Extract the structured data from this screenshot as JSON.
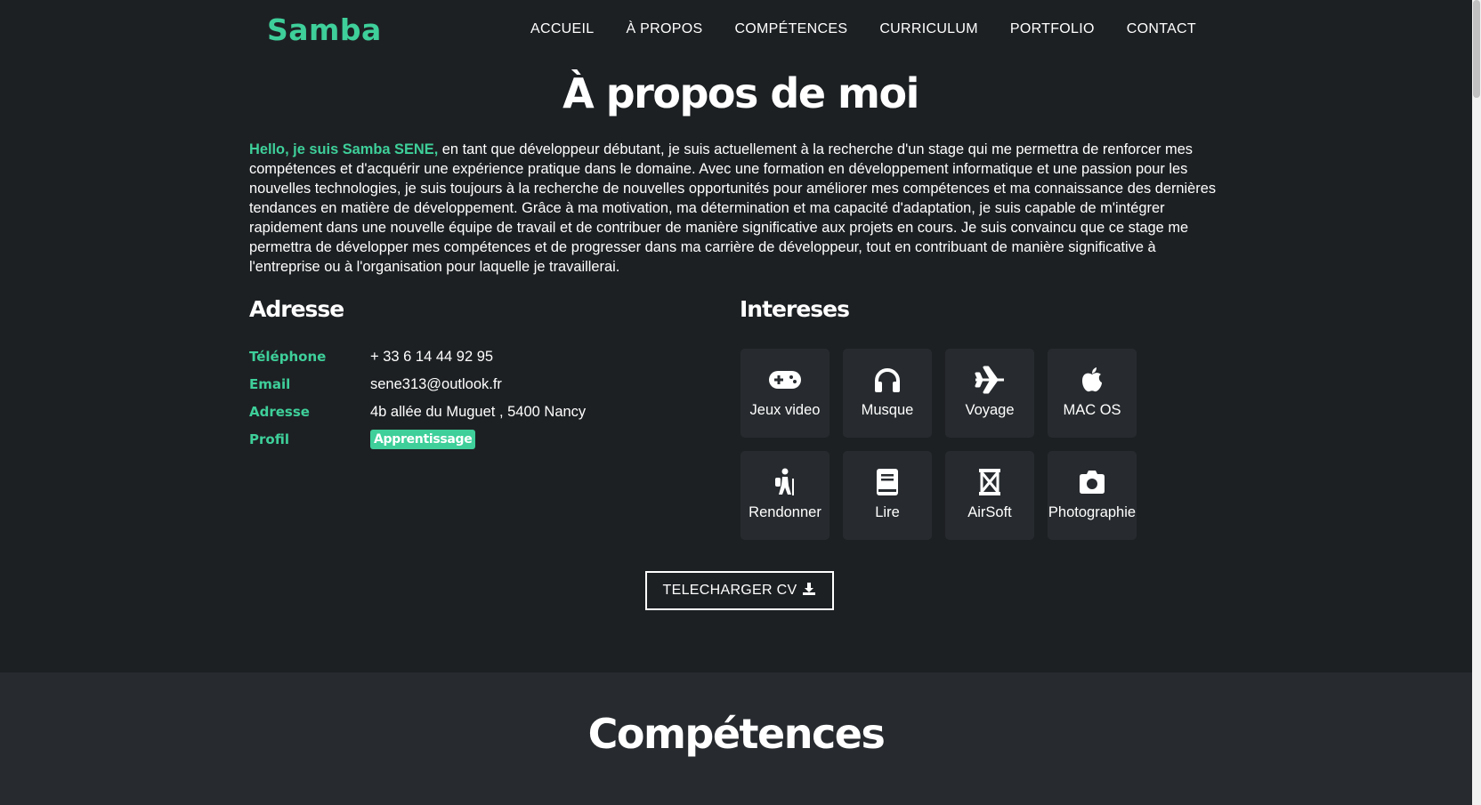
{
  "brand": {
    "logo": "Samba",
    "accent_color": "#3ecf9a",
    "bg_color": "#1d2023",
    "card_color": "#272b2f"
  },
  "nav": {
    "items": [
      "ACCUEIL",
      "À PROPOS",
      "COMPÉTENCES",
      "CURRICULUM",
      "PORTFOLIO",
      "CONTACT"
    ]
  },
  "about": {
    "title": "À propos de moi",
    "intro_highlight": "Hello, je suis Samba SENE,",
    "intro_text": " en tant que développeur débutant, je suis actuellement à la recherche d'un stage qui me permettra de renforcer mes compétences et d'acquérir une expérience pratique dans le domaine. Avec une formation en développement informatique et une passion pour les nouvelles technologies, je suis toujours à la recherche de nouvelles opportunités pour améliorer mes compétences et ma connaissance des dernières tendances en matière de développement. Grâce à ma motivation, ma détermination et ma capacité d'adaptation, je suis capable de m'intégrer rapidement dans une nouvelle équipe de travail et de contribuer de manière significative aux projets en cours. Je suis convaincu que ce stage me permettra de développer mes compétences et de progresser dans ma carrière de développeur, tout en contribuant de manière significative à l'entreprise ou à l'organisation pour laquelle je travaillerai."
  },
  "address": {
    "title": "Adresse",
    "rows": [
      {
        "label": "Téléphone",
        "value": "+ 33 6 14 44 92 95"
      },
      {
        "label": "Email",
        "value": "sene313@outlook.fr"
      },
      {
        "label": "Adresse",
        "value": "4b allée du Muguet , 5400 Nancy"
      },
      {
        "label": "Profil",
        "value": "Apprentissage"
      }
    ]
  },
  "interests": {
    "title": "Intereses",
    "items": [
      {
        "label": "Jeux video",
        "icon": "gamepad-icon"
      },
      {
        "label": "Musque",
        "icon": "headphones-icon"
      },
      {
        "label": "Voyage",
        "icon": "plane-icon"
      },
      {
        "label": "MAC OS",
        "icon": "apple-icon"
      },
      {
        "label": "Rendonner",
        "icon": "hiking-icon"
      },
      {
        "label": "Lire",
        "icon": "book-icon"
      },
      {
        "label": "AirSoft",
        "icon": "hourglass-icon"
      },
      {
        "label": "Photographie",
        "icon": "camera-icon"
      }
    ]
  },
  "cv_button": {
    "label": "TELECHARGER CV",
    "icon": "download-icon"
  },
  "skills": {
    "title": "Compétences"
  }
}
